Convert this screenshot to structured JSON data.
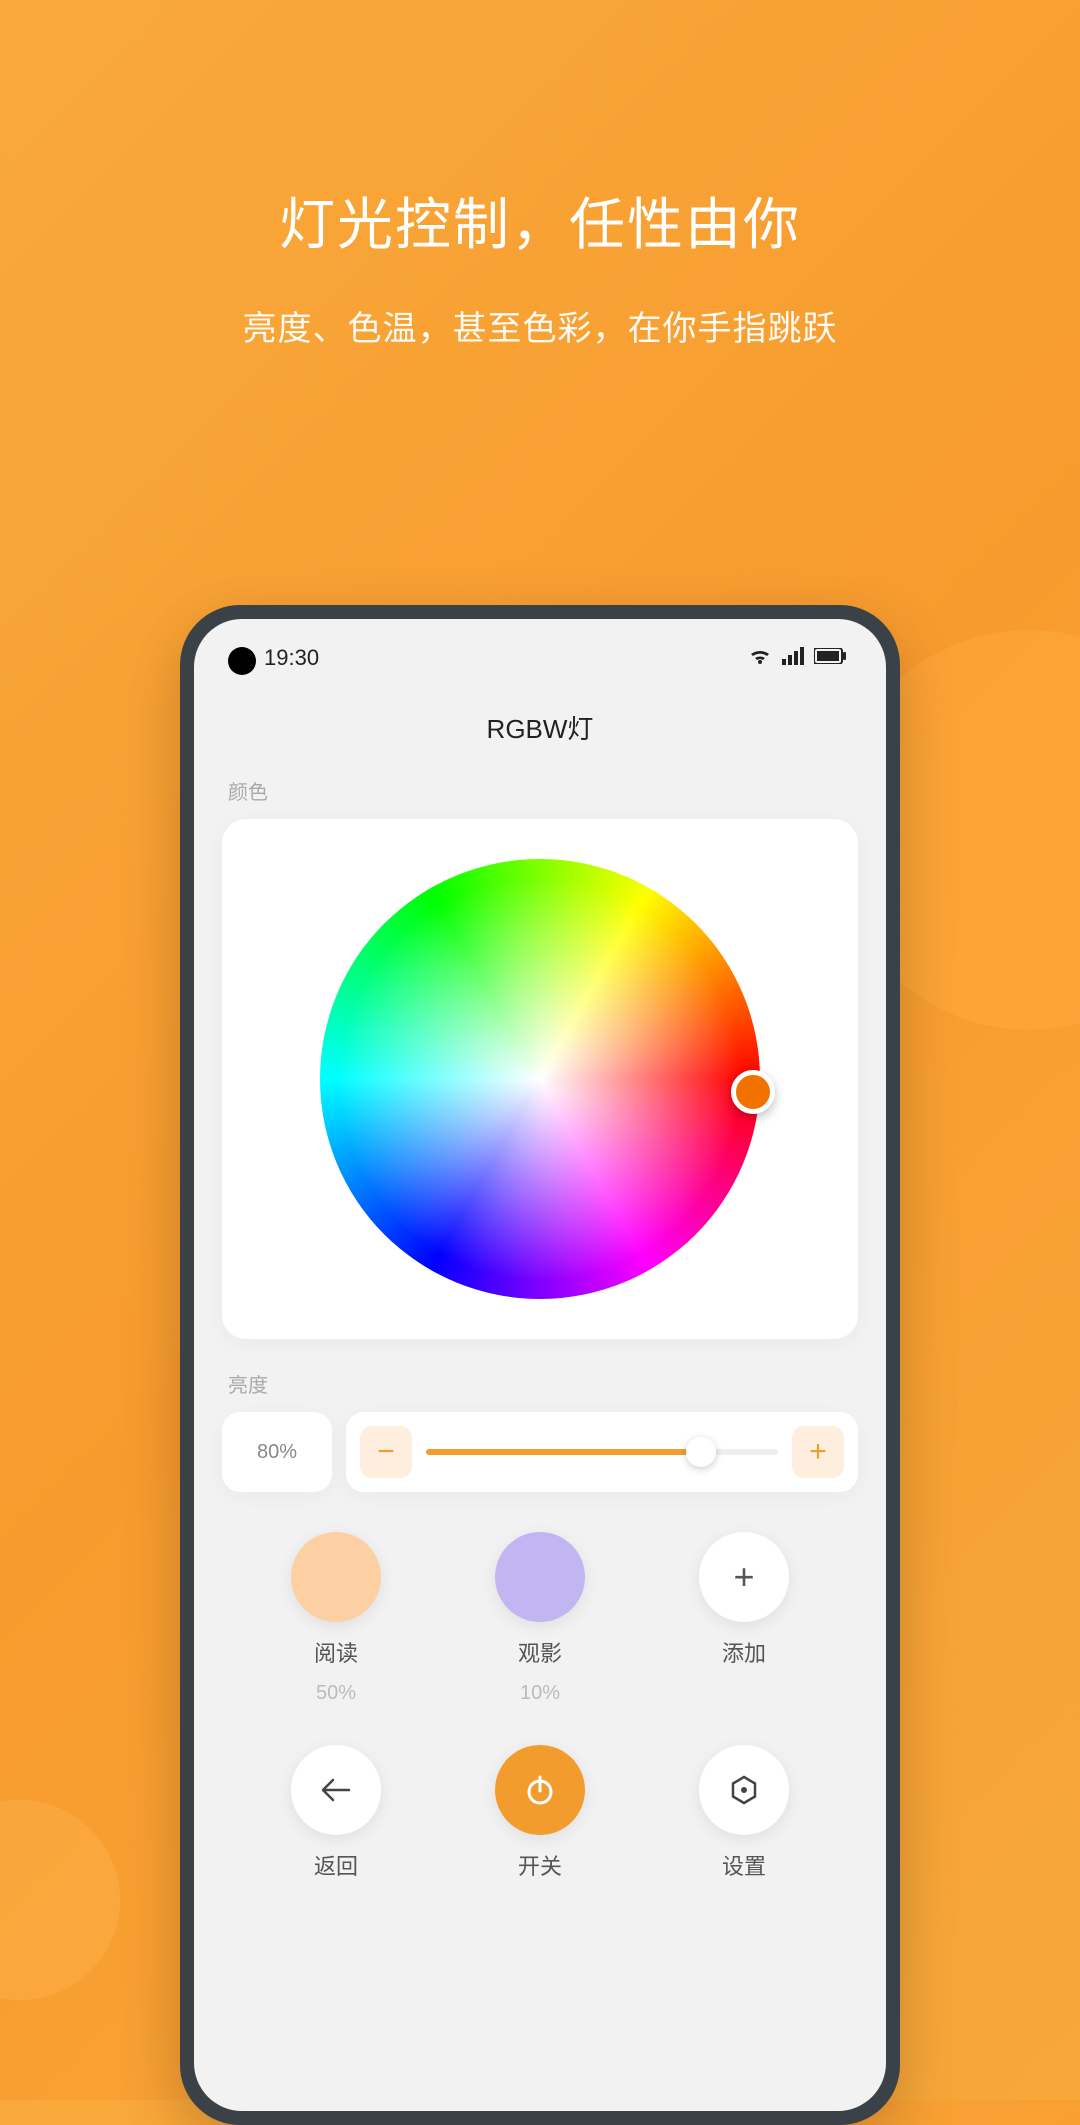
{
  "hero": {
    "title": "灯光控制，任性由你",
    "subtitle": "亮度、色温，甚至色彩，在你手指跳跃"
  },
  "status": {
    "time": "19:30"
  },
  "app": {
    "title": "RGBW灯",
    "color_label": "颜色",
    "brightness_label": "亮度",
    "brightness_value": "80%"
  },
  "scenes": [
    {
      "label": "阅读",
      "percent": "50%"
    },
    {
      "label": "观影",
      "percent": "10%"
    },
    {
      "label": "添加"
    }
  ],
  "actions": {
    "back": "返回",
    "power": "开关",
    "settings": "设置"
  }
}
